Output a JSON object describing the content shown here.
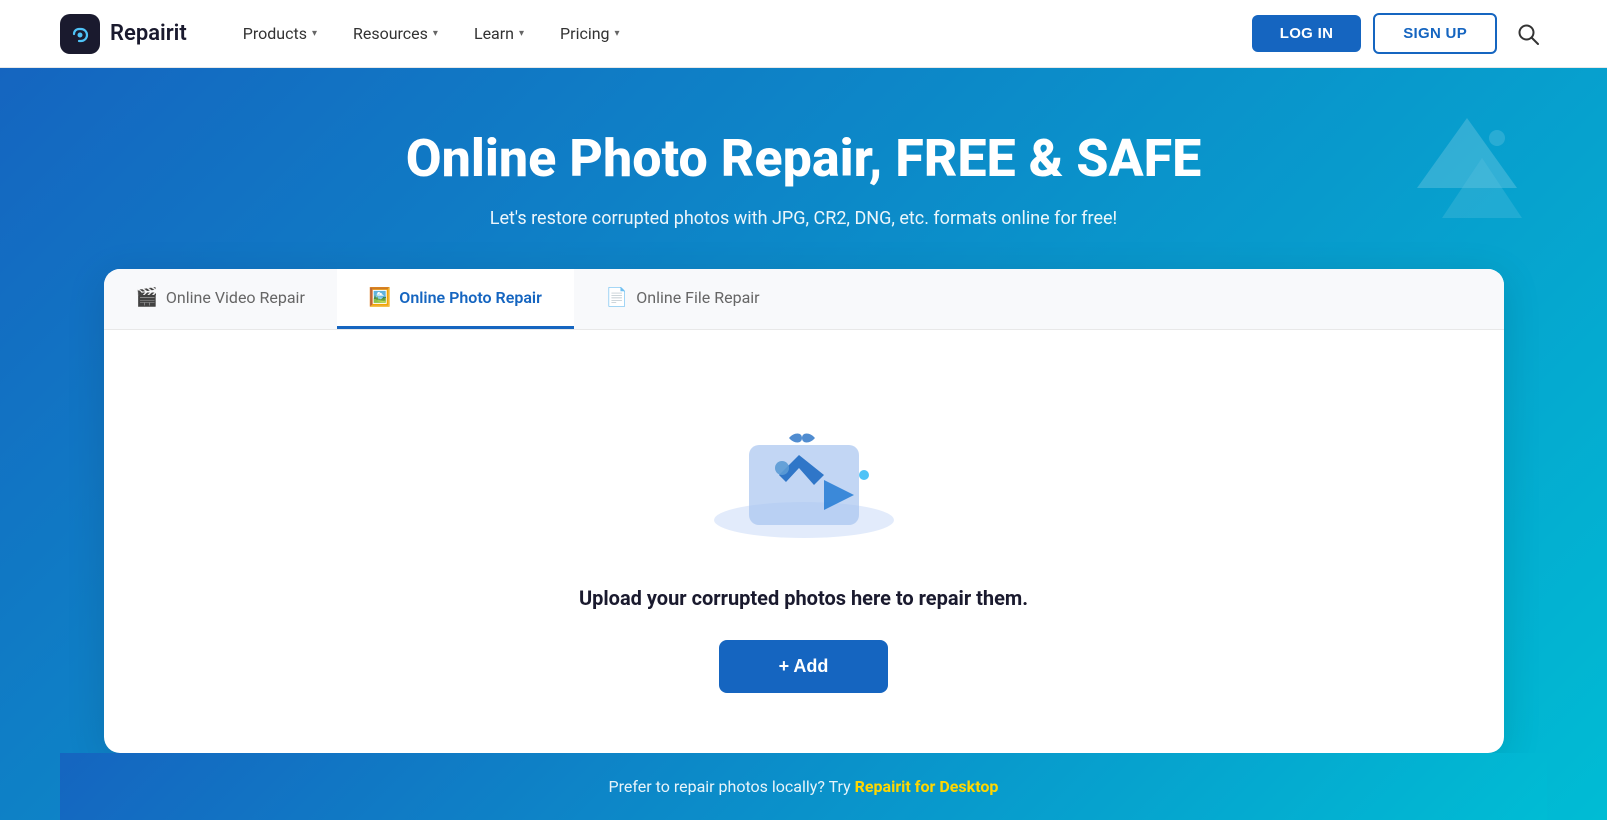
{
  "navbar": {
    "logo_text": "Repairit",
    "nav_items": [
      {
        "label": "Products",
        "has_arrow": true
      },
      {
        "label": "Resources",
        "has_arrow": true
      },
      {
        "label": "Learn",
        "has_arrow": true
      },
      {
        "label": "Pricing",
        "has_arrow": true
      }
    ],
    "login_label": "LOG IN",
    "signup_label": "SIGN UP"
  },
  "hero": {
    "title": "Online Photo Repair, FREE & SAFE",
    "subtitle": "Let's restore corrupted photos with JPG, CR2, DNG, etc. formats online for free!"
  },
  "tabs": [
    {
      "id": "video",
      "label": "Online Video Repair",
      "active": false
    },
    {
      "id": "photo",
      "label": "Online Photo Repair",
      "active": true
    },
    {
      "id": "file",
      "label": "Online File Repair",
      "active": false
    }
  ],
  "card": {
    "upload_text": "Upload your corrupted photos here to repair them.",
    "add_button_label": "+ Add"
  },
  "footer_hint": {
    "text": "Prefer to repair photos locally? Try ",
    "link_label": "Repairit for Desktop"
  }
}
